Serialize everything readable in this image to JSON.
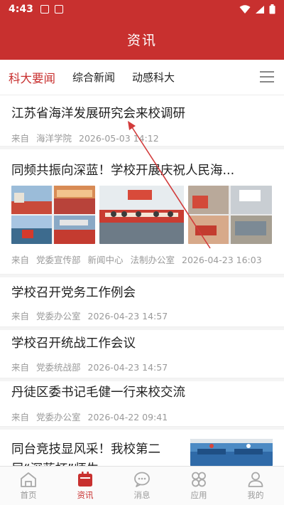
{
  "status_bar": {
    "time": "4:43"
  },
  "header": {
    "title": "资讯"
  },
  "tabs": [
    {
      "label": "科大要闻"
    },
    {
      "label": "综合新闻"
    },
    {
      "label": "动感科大"
    }
  ],
  "articles": [
    {
      "title": "江苏省海洋发展研究会来校调研",
      "from_label": "来自",
      "sources": [
        "海洋学院"
      ],
      "date": "2026-05-03 14:12"
    },
    {
      "title": "同频共振向深蓝！学校开展庆祝人民海...",
      "from_label": "来自",
      "sources": [
        "党委宣传部",
        "新闻中心",
        "法制办公室"
      ],
      "date": "2026-04-23 16:03"
    },
    {
      "title": "学校召开党务工作例会",
      "from_label": "来自",
      "sources": [
        "党委办公室"
      ],
      "date": "2026-04-23 14:57"
    },
    {
      "title": "学校召开统战工作会议",
      "from_label": "来自",
      "sources": [
        "党委统战部"
      ],
      "date": "2026-04-23 14:57"
    },
    {
      "title": "丹徒区委书记毛健一行来校交流",
      "from_label": "来自",
      "sources": [
        "党委办公室"
      ],
      "date": "2026-04-22 09:41"
    },
    {
      "title_line1": "同台竞技显风采！我校第二",
      "title_line2": "届“深蓝杯”师生"
    }
  ],
  "bottom_nav": [
    {
      "label": "首页",
      "icon": "home-icon"
    },
    {
      "label": "资讯",
      "icon": "news-icon"
    },
    {
      "label": "消息",
      "icon": "message-icon"
    },
    {
      "label": "应用",
      "icon": "apps-icon"
    },
    {
      "label": "我的",
      "icon": "profile-icon"
    }
  ],
  "colors": {
    "primary": "#c8302f",
    "muted": "#9a9a9a",
    "arrow": "#d23b3b"
  }
}
